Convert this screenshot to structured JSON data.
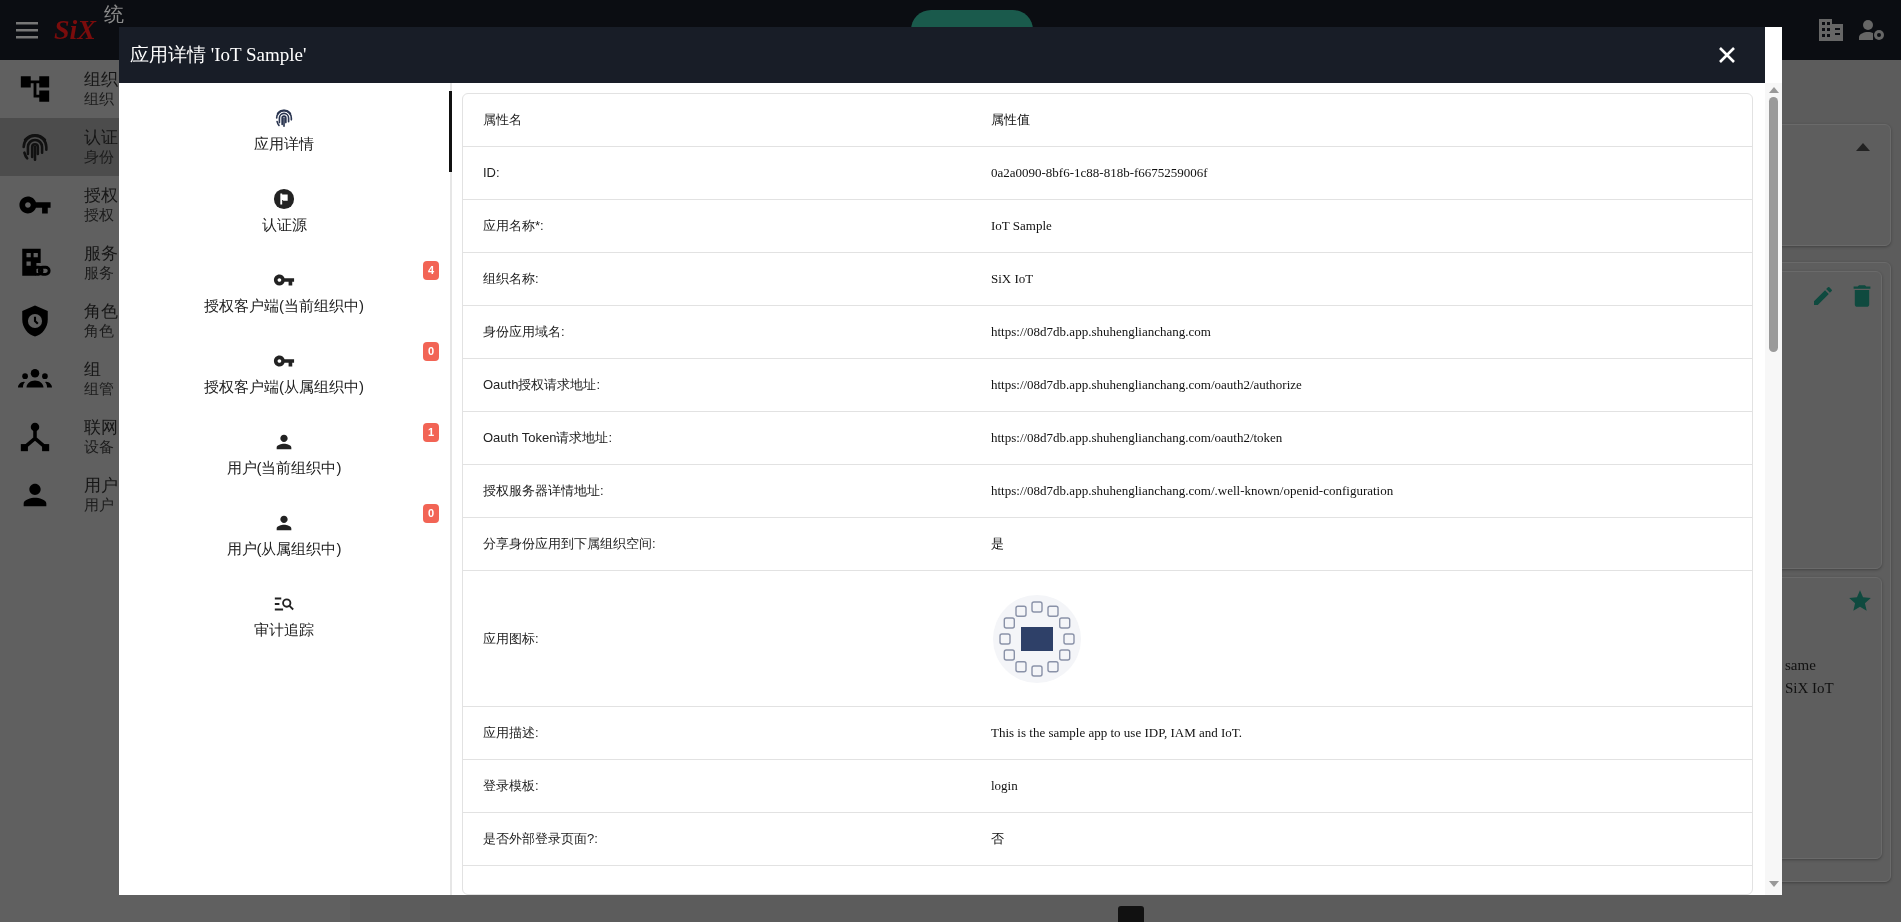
{
  "topbar": {
    "logo": "SiX",
    "title": "统"
  },
  "sidebar": {
    "items": [
      {
        "title": "组织",
        "subtitle": "组织",
        "selected": false
      },
      {
        "title": "认证",
        "subtitle": "身份",
        "selected": true
      },
      {
        "title": "授权",
        "subtitle": "授权",
        "selected": false
      },
      {
        "title": "服务",
        "subtitle": "服务",
        "selected": false
      },
      {
        "title": "角色",
        "subtitle": "角色",
        "selected": false
      },
      {
        "title": "组",
        "subtitle": "组管",
        "selected": false
      },
      {
        "title": "联网",
        "subtitle": "设备",
        "selected": false
      },
      {
        "title": "用户",
        "subtitle": "用户",
        "selected": false
      }
    ]
  },
  "background_card": {
    "lines": [
      "same",
      "SiX IoT"
    ]
  },
  "modal": {
    "title": "应用详情 'IoT Sample'",
    "nav": [
      {
        "label": "应用详情",
        "selected": true
      },
      {
        "label": "认证源",
        "selected": false
      },
      {
        "label": "授权客户端(当前组织中)",
        "badge": "4",
        "selected": false
      },
      {
        "label": "授权客户端(从属组织中)",
        "badge": "0",
        "selected": false
      },
      {
        "label": "用户(当前组织中)",
        "badge": "1",
        "selected": false
      },
      {
        "label": "用户(从属组织中)",
        "badge": "0",
        "selected": false
      },
      {
        "label": "审计追踪",
        "selected": false
      }
    ],
    "table": {
      "columns": [
        "属性名",
        "属性值"
      ],
      "rows": [
        {
          "name": "ID:",
          "kind": "text",
          "value": "0a2a0090-8bf6-1c88-818b-f6675259006f"
        },
        {
          "name": "应用名称*:",
          "kind": "text",
          "value": "IoT Sample"
        },
        {
          "name": "组织名称:",
          "kind": "text",
          "value": "SiX IoT"
        },
        {
          "name": "身份应用域名:",
          "kind": "text",
          "value": "https://08d7db.app.shuhenglianchang.com"
        },
        {
          "name": "Oauth授权请求地址:",
          "kind": "text",
          "value": "https://08d7db.app.shuhenglianchang.com/oauth2/authorize"
        },
        {
          "name": "Oauth Token请求地址:",
          "kind": "text",
          "value": "https://08d7db.app.shuhenglianchang.com/oauth2/token"
        },
        {
          "name": "授权服务器详情地址:",
          "kind": "text",
          "value": "https://08d7db.app.shuhenglianchang.com/.well-known/openid-configuration"
        },
        {
          "name": "分享身份应用到下属组织空间:",
          "kind": "text",
          "value": "是"
        },
        {
          "name": "应用图标:",
          "kind": "picture"
        },
        {
          "name": "应用描述:",
          "kind": "text",
          "value": "This is the sample app to use IDP, IAM and IoT."
        },
        {
          "name": "登录模板:",
          "kind": "text",
          "value": "login"
        },
        {
          "name": "是否外部登录页面?:",
          "kind": "text",
          "value": "否"
        }
      ]
    }
  }
}
